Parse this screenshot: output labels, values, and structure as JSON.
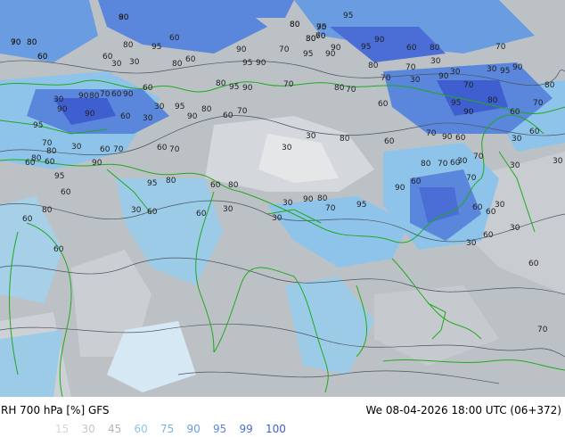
{
  "footer": {
    "title": "RH 700 hPa [%] GFS",
    "timestamp": "We 08-04-2026 18:00 UTC (06+372)"
  },
  "legend": [
    {
      "label": "15",
      "color": "#d2d6da"
    },
    {
      "label": "30",
      "color": "#c0c6cc"
    },
    {
      "label": "45",
      "color": "#aeb6be"
    },
    {
      "label": "60",
      "color": "#8ec4ea"
    },
    {
      "label": "75",
      "color": "#7fb0e6"
    },
    {
      "label": "90",
      "color": "#6a9ce2"
    },
    {
      "label": "95",
      "color": "#5a86dc"
    },
    {
      "label": "99",
      "color": "#4a6ed6"
    },
    {
      "label": "100",
      "color": "#3f5fd0"
    }
  ],
  "contour_labels": [
    {
      "t": "90"
    },
    {
      "t": "90"
    },
    {
      "t": "80"
    },
    {
      "t": "60"
    },
    {
      "t": "80"
    },
    {
      "t": "95"
    },
    {
      "t": "70"
    },
    {
      "t": "30"
    },
    {
      "t": "90"
    },
    {
      "t": "95"
    },
    {
      "t": "90"
    },
    {
      "t": "60"
    },
    {
      "t": "80"
    },
    {
      "t": "95"
    },
    {
      "t": "70"
    },
    {
      "t": "80"
    },
    {
      "t": "60"
    },
    {
      "t": "95"
    },
    {
      "t": "90"
    },
    {
      "t": "95"
    },
    {
      "t": "90"
    },
    {
      "t": "70"
    },
    {
      "t": "60"
    },
    {
      "t": "30"
    },
    {
      "t": "30"
    },
    {
      "t": "80"
    },
    {
      "t": "60"
    },
    {
      "t": "95"
    },
    {
      "t": "90"
    },
    {
      "t": "80"
    },
    {
      "t": "70"
    },
    {
      "t": "30"
    },
    {
      "t": "90"
    },
    {
      "t": "30"
    },
    {
      "t": "70"
    },
    {
      "t": "30"
    },
    {
      "t": "95"
    },
    {
      "t": "90"
    },
    {
      "t": "80"
    },
    {
      "t": "70"
    },
    {
      "t": "95"
    },
    {
      "t": "90"
    },
    {
      "t": "80"
    },
    {
      "t": "60"
    },
    {
      "t": "30"
    },
    {
      "t": "90"
    },
    {
      "t": "90"
    },
    {
      "t": "80"
    },
    {
      "t": "70"
    },
    {
      "t": "60"
    },
    {
      "t": "90"
    },
    {
      "t": "60"
    },
    {
      "t": "80"
    },
    {
      "t": "95"
    },
    {
      "t": "90"
    },
    {
      "t": "70"
    },
    {
      "t": "80"
    },
    {
      "t": "70"
    },
    {
      "t": "60"
    },
    {
      "t": "70"
    },
    {
      "t": "30"
    },
    {
      "t": "90"
    },
    {
      "t": "60"
    },
    {
      "t": "30"
    },
    {
      "t": "30"
    },
    {
      "t": "95"
    },
    {
      "t": "90"
    },
    {
      "t": "80"
    },
    {
      "t": "60"
    },
    {
      "t": "70"
    },
    {
      "t": "95"
    },
    {
      "t": "70"
    },
    {
      "t": "80"
    },
    {
      "t": "30"
    },
    {
      "t": "60"
    },
    {
      "t": "70"
    },
    {
      "t": "60"
    },
    {
      "t": "70"
    },
    {
      "t": "30"
    },
    {
      "t": "30"
    },
    {
      "t": "80"
    },
    {
      "t": "60"
    },
    {
      "t": "70"
    },
    {
      "t": "90"
    },
    {
      "t": "60"
    },
    {
      "t": "30"
    },
    {
      "t": "60"
    },
    {
      "t": "60"
    },
    {
      "t": "80"
    },
    {
      "t": "60"
    },
    {
      "t": "95"
    },
    {
      "t": "90"
    },
    {
      "t": "95"
    },
    {
      "t": "80"
    },
    {
      "t": "60"
    },
    {
      "t": "80"
    },
    {
      "t": "70"
    },
    {
      "t": "30"
    },
    {
      "t": "30"
    },
    {
      "t": "60"
    },
    {
      "t": "80"
    },
    {
      "t": "60"
    },
    {
      "t": "30"
    },
    {
      "t": "60"
    },
    {
      "t": "60"
    },
    {
      "t": "30"
    },
    {
      "t": "30"
    },
    {
      "t": "30"
    },
    {
      "t": "90"
    },
    {
      "t": "80"
    },
    {
      "t": "70"
    },
    {
      "t": "95"
    },
    {
      "t": "90"
    },
    {
      "t": "60"
    },
    {
      "t": "80"
    },
    {
      "t": "70"
    },
    {
      "t": "60"
    },
    {
      "t": "30"
    },
    {
      "t": "70"
    },
    {
      "t": "60"
    },
    {
      "t": "60"
    },
    {
      "t": "30"
    },
    {
      "t": "30"
    },
    {
      "t": "60"
    },
    {
      "t": "30"
    },
    {
      "t": "60"
    },
    {
      "t": "70"
    },
    {
      "t": "60"
    },
    {
      "t": "80"
    },
    {
      "t": "70"
    },
    {
      "t": "30"
    },
    {
      "t": "60"
    },
    {
      "t": "80"
    },
    {
      "t": "70"
    },
    {
      "t": "60"
    },
    {
      "t": "80"
    }
  ]
}
